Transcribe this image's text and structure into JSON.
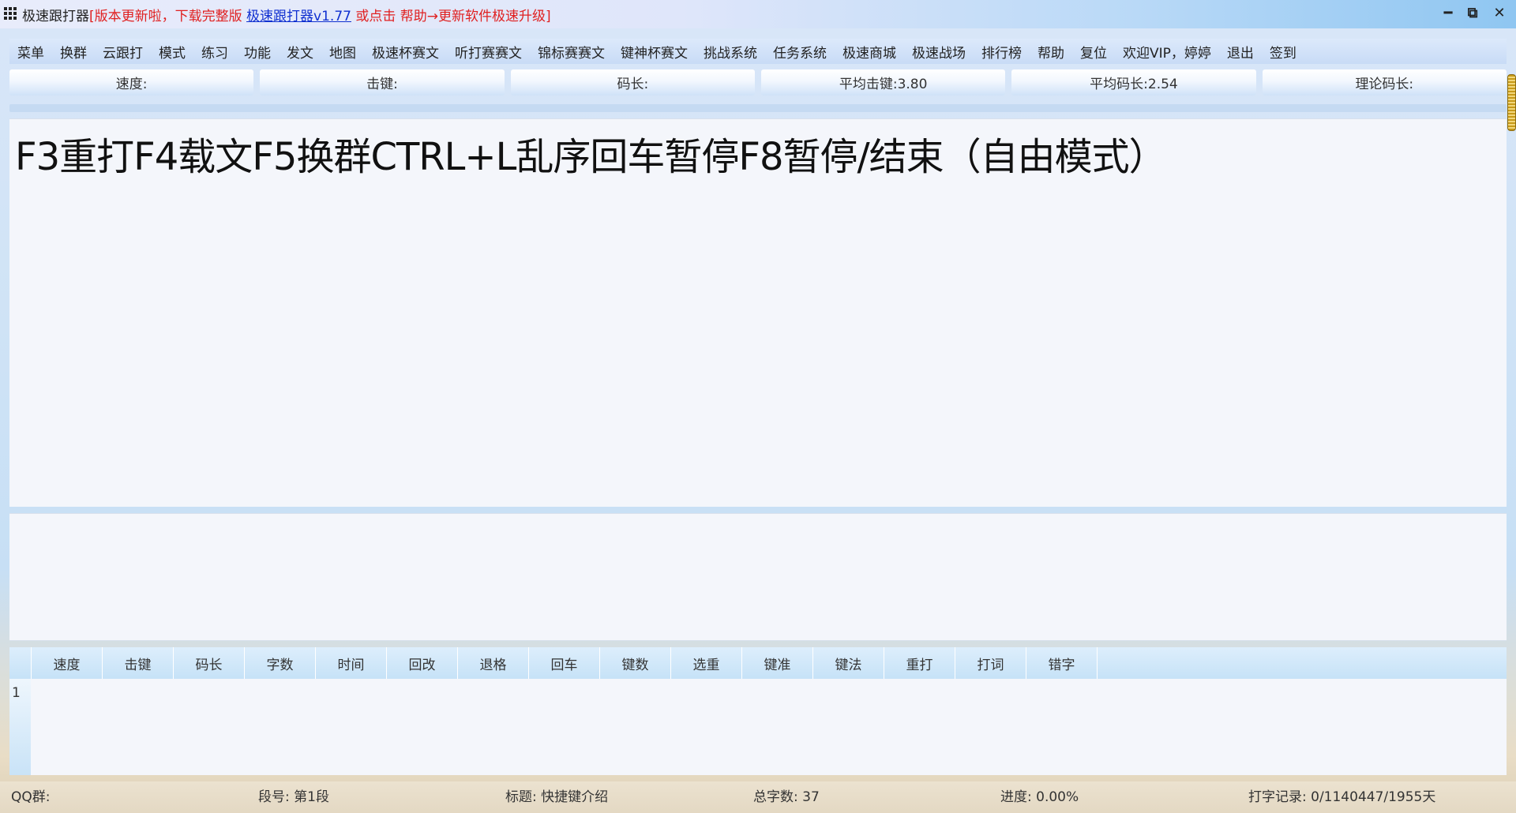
{
  "window": {
    "app_name": "极速跟打器",
    "notice_prefix": "[版本更新啦，下载完整版 ",
    "link_text": "极速跟打器v1.77",
    "notice_suffix": " 或点击 帮助→更新软件极速升级]",
    "minimize": "━",
    "restore": "⧉",
    "close": "✕"
  },
  "menu": [
    "菜单",
    "换群",
    "云跟打",
    "模式",
    "练习",
    "功能",
    "发文",
    "地图",
    "极速杯赛文",
    "听打赛赛文",
    "锦标赛赛文",
    "键神杯赛文",
    "挑战系统",
    "任务系统",
    "极速商城",
    "极速战场",
    "排行榜",
    "帮助",
    "复位",
    "欢迎VIP，婷婷",
    "退出",
    "签到"
  ],
  "stats": [
    "速度:",
    "击键:",
    "码长:",
    "平均击键:3.80",
    "平均码长:2.54",
    "理论码长:"
  ],
  "progress_fraction": 0,
  "text_area": {
    "content": "F3重打F4载文F5换群CTRL+L乱序回车暂停F8暂停/结束（自由模式）"
  },
  "grid": {
    "columns": [
      "速度",
      "击键",
      "码长",
      "字数",
      "时间",
      "回改",
      "退格",
      "回车",
      "键数",
      "选重",
      "键准",
      "键法",
      "重打",
      "打词",
      "错字"
    ],
    "row_number": "1"
  },
  "status": {
    "qq_group": "QQ群:",
    "segment": "段号: 第1段",
    "title": "标题: 快捷键介绍",
    "total_chars": "总字数: 37",
    "progress": "进度: 0.00%",
    "record": "打字记录: 0/1140447/1955天"
  },
  "colors": {
    "notice_red": "#e02020",
    "link_blue": "#1030d0",
    "menu_bg": "#c8dbf6",
    "scroll_thumb": "#c79a1a"
  }
}
